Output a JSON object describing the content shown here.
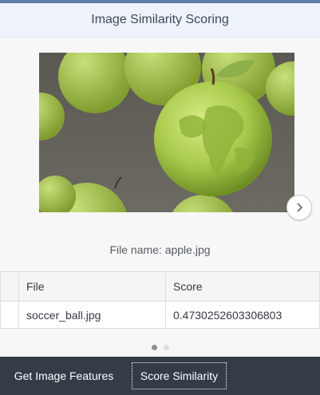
{
  "header": {
    "title": "Image Similarity Scoring"
  },
  "carousel": {
    "image": "green apple with world map texture among green apples",
    "next_icon": "chevron-right-icon",
    "file_label": "File name:",
    "file_name": "apple.jpg",
    "pages": 2,
    "active_page": 1
  },
  "table": {
    "columns": [
      "File",
      "Score"
    ],
    "rows": [
      {
        "file": "soccer_ball.jpg",
        "score": "0.4730252603306803"
      }
    ]
  },
  "footer": {
    "get_features_label": "Get Image Features",
    "score_label": "Score Similarity"
  },
  "colors": {
    "accent": "#5d7dab",
    "header_bg": "#eef2fb",
    "footer_bg": "#343c48"
  }
}
